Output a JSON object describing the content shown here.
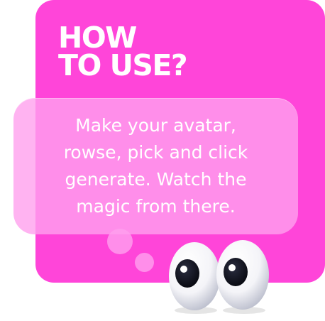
{
  "card": {
    "title": "HOW\nTO USE?",
    "body": "Make your avatar, rowse, pick and click generate. Watch the magic from there."
  },
  "decorations": {
    "eyes": "eyes-icon"
  },
  "colors": {
    "card_background": "#ff45d9",
    "bubble_background": "#ffa0ee",
    "text": "#ffffff"
  }
}
